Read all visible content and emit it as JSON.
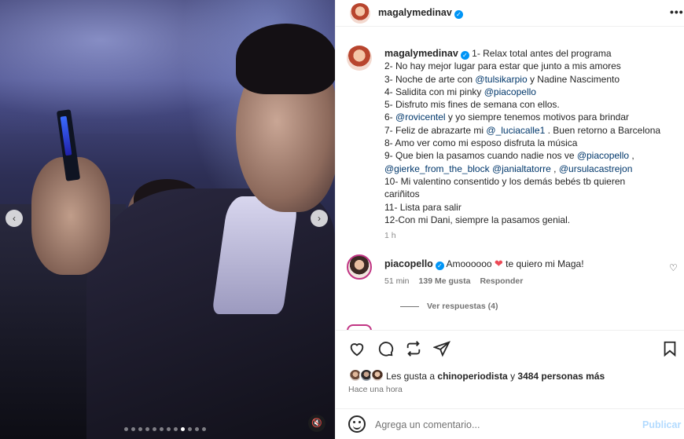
{
  "post": {
    "username": "magalymedinav",
    "caption_lines": [
      {
        "parts": [
          {
            "t": "1- Relax total antes del programa"
          }
        ]
      },
      {
        "parts": [
          {
            "t": "2- No hay mejor lugar para estar que junto a mis amores"
          }
        ]
      },
      {
        "parts": [
          {
            "t": "3- Noche de arte con "
          },
          {
            "t": "@tulsikarpio",
            "m": true
          },
          {
            "t": " y Nadine Nascimento"
          }
        ]
      },
      {
        "parts": [
          {
            "t": "4- Salidita con mi pinky "
          },
          {
            "t": "@piacopello",
            "m": true
          }
        ]
      },
      {
        "parts": [
          {
            "t": "5- Disfruto mis fines de semana con ellos."
          }
        ]
      },
      {
        "parts": [
          {
            "t": "6- "
          },
          {
            "t": "@rovicentel",
            "m": true
          },
          {
            "t": " y yo siempre tenemos motivos para brindar"
          }
        ]
      },
      {
        "parts": [
          {
            "t": "7- Feliz de abrazarte mi "
          },
          {
            "t": "@_luciacalle1",
            "m": true
          },
          {
            "t": " . Buen retorno a Barcelona"
          }
        ]
      },
      {
        "parts": [
          {
            "t": "8- Amo ver como mi esposo disfruta la música"
          }
        ]
      },
      {
        "parts": [
          {
            "t": "9- Que bien la pasamos cuando nadie nos ve "
          },
          {
            "t": "@piacopello",
            "m": true
          },
          {
            "t": " ,"
          }
        ]
      },
      {
        "parts": [
          {
            "t": "@gierke_from_the_block",
            "m": true
          },
          {
            "t": " "
          },
          {
            "t": "@janialtatorre",
            "m": true
          },
          {
            "t": " , "
          },
          {
            "t": "@ursulacastrejon",
            "m": true
          }
        ]
      },
      {
        "parts": [
          {
            "t": "10- Mi valentino consentido y los demás bebés tb quieren"
          }
        ]
      },
      {
        "parts": [
          {
            "t": "cariñitos"
          }
        ]
      },
      {
        "parts": [
          {
            "t": "11- Lista para salir"
          }
        ]
      },
      {
        "parts": [
          {
            "t": "12-Con mi Dani, siempre la pasamos genial."
          }
        ]
      }
    ],
    "caption_time": "1 h",
    "carousel_dots": 12,
    "carousel_active_index": 8
  },
  "comment": {
    "username": "piacopello",
    "text": "Amoooooo",
    "heart": "❤",
    "text_after": "te quiero mi Maga!",
    "time": "51 min",
    "likes": "139 Me gusta",
    "reply_label": "Responder",
    "view_replies": "Ver respuestas (4)"
  },
  "likes": {
    "prefix": "Les gusta a ",
    "user": "chinoperiodista",
    "middle": " y ",
    "count": "3484 personas más"
  },
  "time_ago": "Hace una hora",
  "comment_box": {
    "placeholder": "Agrega un comentario...",
    "publish_label": "Publicar"
  },
  "icons": {
    "prev": "‹",
    "next": "›",
    "more": "•••",
    "verified": "✓",
    "mute": "🔇",
    "comment_like": "♡"
  },
  "colors": {
    "link": "#00376b",
    "verified": "#0095f6",
    "heart": "#ed4956",
    "publish_disabled": "#b3dbff"
  }
}
